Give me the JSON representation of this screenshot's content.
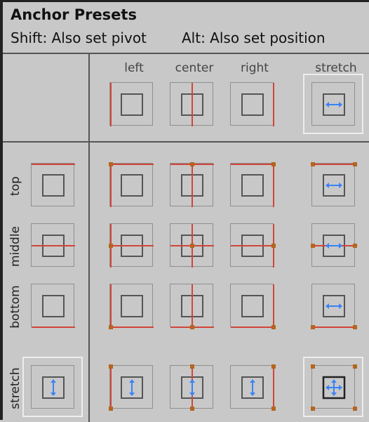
{
  "title": "Anchor Presets",
  "hints": {
    "shift": "Shift: Also set pivot",
    "alt": "Alt: Also set position"
  },
  "columns": [
    "left",
    "center",
    "right",
    "stretch"
  ],
  "rows": [
    "top",
    "middle",
    "bottom",
    "stretch"
  ],
  "colors": {
    "background": "#c8c8c8",
    "anchor_line": "#d0453a",
    "anchor_handle": "#b5651d",
    "stretch_arrow": "#3b82f6",
    "selection_outline": "#ededed"
  },
  "selected": [
    {
      "row": "none",
      "col": "stretch"
    },
    {
      "row": "stretch",
      "col": "none"
    },
    {
      "row": "stretch",
      "col": "stretch"
    }
  ]
}
